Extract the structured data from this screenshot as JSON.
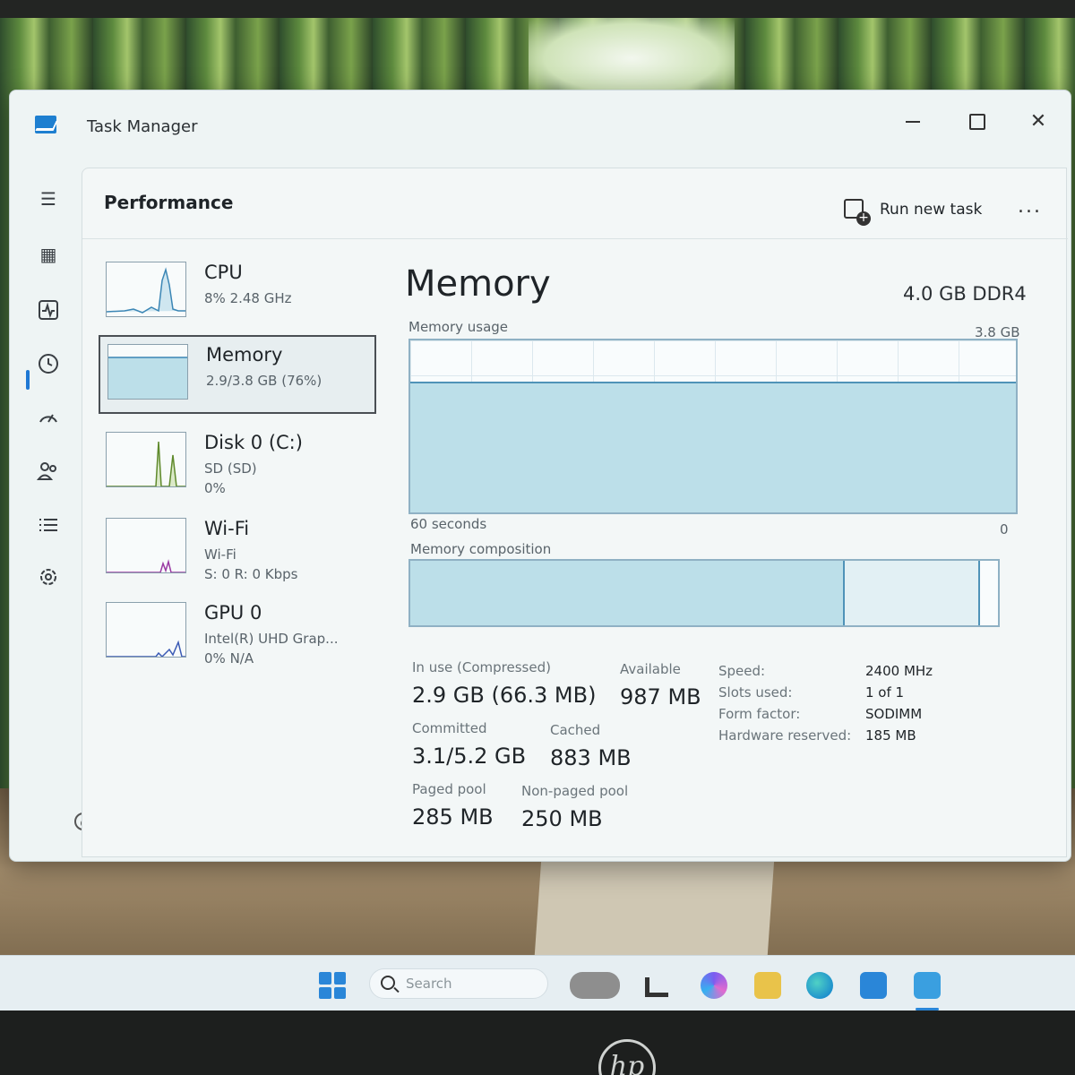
{
  "window": {
    "title": "Task Manager"
  },
  "header": {
    "page_title": "Performance",
    "run_new_task": "Run new task",
    "more": "..."
  },
  "nav": [
    {
      "name": "hamburger-menu-icon"
    },
    {
      "name": "processes-icon"
    },
    {
      "name": "performance-icon",
      "selected": true
    },
    {
      "name": "app-history-icon"
    },
    {
      "name": "startup-apps-icon"
    },
    {
      "name": "users-icon"
    },
    {
      "name": "details-icon"
    },
    {
      "name": "services-icon"
    },
    {
      "name": "settings-icon"
    }
  ],
  "resources": [
    {
      "name": "CPU",
      "line1": "8%  2.48 GHz",
      "line2": ""
    },
    {
      "name": "Memory",
      "line1": "2.9/3.8 GB (76%)",
      "line2": ""
    },
    {
      "name": "Disk 0 (C:)",
      "line1": "SD (SD)",
      "line2": "0%"
    },
    {
      "name": "Wi-Fi",
      "line1": "Wi-Fi",
      "line2": "S: 0  R: 0 Kbps"
    },
    {
      "name": "GPU 0",
      "line1": "Intel(R) UHD Grap...",
      "line2": "0%  N/A"
    }
  ],
  "memory": {
    "title": "Memory",
    "type": "4.0 GB DDR4",
    "usage_label": "Memory usage",
    "usage_max": "3.8 GB",
    "x_left": "60 seconds",
    "x_right": "0",
    "usage_fraction": 0.76,
    "composition_label": "Memory composition",
    "composition_inuse_fraction": 0.74,
    "composition_standby_end_fraction": 0.97,
    "stats": {
      "in_use_label": "In use (Compressed)",
      "in_use_value": "2.9 GB (66.3 MB)",
      "available_label": "Available",
      "available_value": "987 MB",
      "committed_label": "Committed",
      "committed_value": "3.1/5.2 GB",
      "cached_label": "Cached",
      "cached_value": "883 MB",
      "paged_pool_label": "Paged pool",
      "paged_pool_value": "285 MB",
      "non_paged_pool_label": "Non-paged pool",
      "non_paged_pool_value": "250 MB"
    },
    "details": [
      {
        "key": "Speed:",
        "value": "2400 MHz"
      },
      {
        "key": "Slots used:",
        "value": "1 of 1"
      },
      {
        "key": "Form factor:",
        "value": "SODIMM"
      },
      {
        "key": "Hardware reserved:",
        "value": "185 MB"
      }
    ]
  },
  "taskbar": {
    "search_placeholder": "Search"
  },
  "device": {
    "logo": "hp"
  }
}
